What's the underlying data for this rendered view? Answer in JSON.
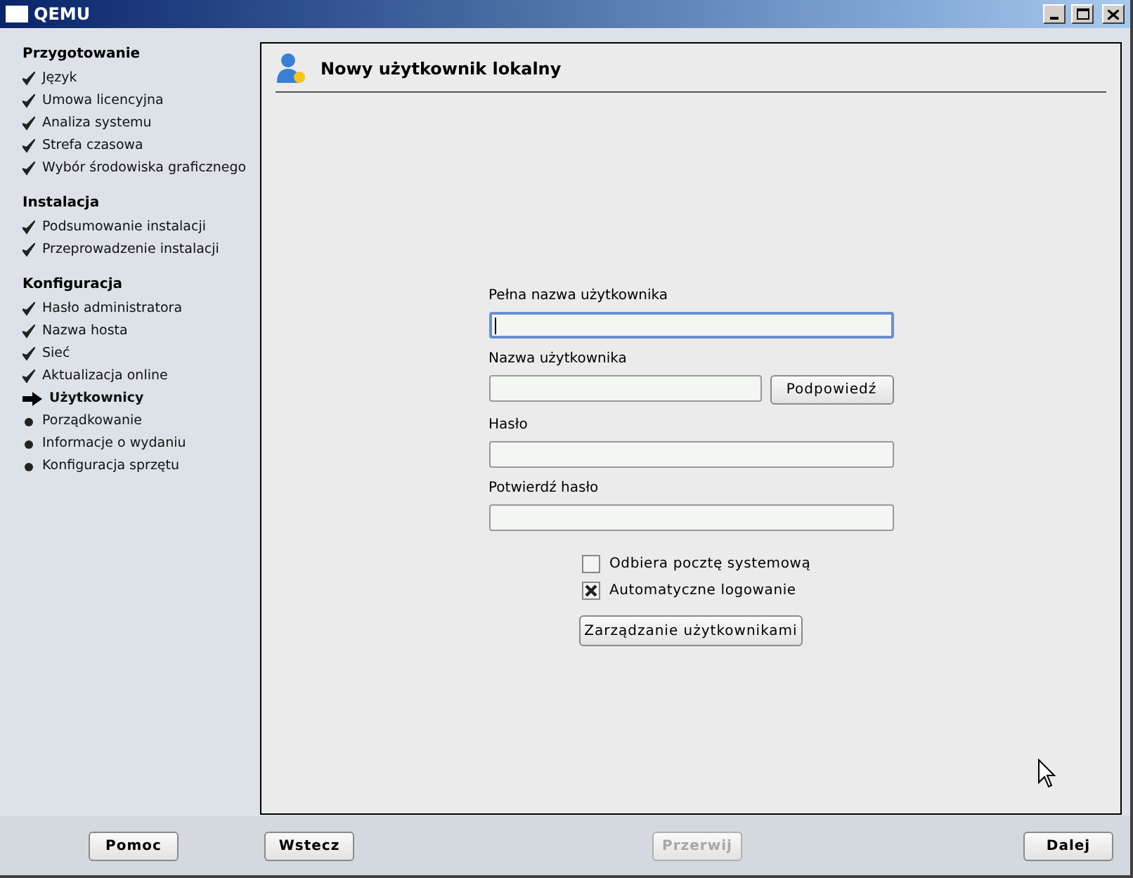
{
  "window": {
    "title": "QEMU"
  },
  "sidebar": {
    "sections": [
      {
        "title": "Przygotowanie",
        "items": [
          {
            "label": "Język",
            "kind": "done"
          },
          {
            "label": "Umowa licencyjna",
            "kind": "done"
          },
          {
            "label": "Analiza systemu",
            "kind": "done"
          },
          {
            "label": "Strefa czasowa",
            "kind": "done"
          },
          {
            "label": "Wybór środowiska graficznego",
            "kind": "done"
          }
        ]
      },
      {
        "title": "Instalacja",
        "items": [
          {
            "label": "Podsumowanie instalacji",
            "kind": "done"
          },
          {
            "label": "Przeprowadzenie instalacji",
            "kind": "done"
          }
        ]
      },
      {
        "title": "Konfiguracja",
        "items": [
          {
            "label": "Hasło administratora",
            "kind": "done"
          },
          {
            "label": "Nazwa hosta",
            "kind": "done"
          },
          {
            "label": "Sieć",
            "kind": "done"
          },
          {
            "label": "Aktualizacja online",
            "kind": "done"
          },
          {
            "label": "Użytkownicy",
            "kind": "current"
          },
          {
            "label": "Porządkowanie",
            "kind": "pending"
          },
          {
            "label": "Informacje o wydaniu",
            "kind": "pending"
          },
          {
            "label": "Konfiguracja sprzętu",
            "kind": "pending"
          }
        ]
      }
    ]
  },
  "panel": {
    "title": "Nowy użytkownik lokalny",
    "fields": [
      {
        "label": "Pełna nazwa użytkownika",
        "focused": true
      },
      {
        "label": "Nazwa użytkownika",
        "focused": false,
        "button": "Podpowiedź"
      },
      {
        "label": "Hasło",
        "focused": false
      },
      {
        "label": "Potwierdź hasło",
        "focused": false
      }
    ],
    "checkboxes": [
      {
        "label": "Odbiera pocztę systemową",
        "checked": false
      },
      {
        "label": "Automatyczne logowanie",
        "checked": true
      }
    ],
    "manage_button": "Zarządzanie użytkownikami"
  },
  "buttons": [
    {
      "label": "Pomoc",
      "disabled": false
    },
    {
      "label": "Wstecz",
      "disabled": false
    },
    {
      "label": "Przerwij",
      "disabled": true
    },
    {
      "label": "Dalej",
      "disabled": false
    }
  ]
}
